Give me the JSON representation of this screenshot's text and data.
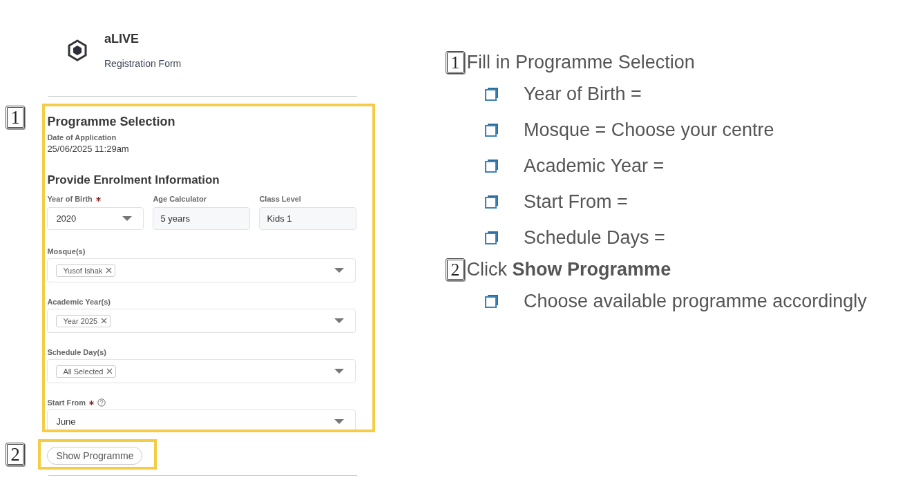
{
  "app": {
    "name": "aLIVE",
    "subtitle": "Registration Form"
  },
  "form": {
    "step": "1",
    "title": "Programme Selection",
    "date_label": "Date of Application",
    "date_value": "25/06/2025 11:29am",
    "section": "Provide Enrolment Information",
    "row_fields": [
      {
        "label": "Year of Birth",
        "required": true,
        "kind": "select",
        "value": "2020"
      },
      {
        "label": "Age Calculator",
        "required": false,
        "kind": "readonly",
        "value": "5 years"
      },
      {
        "label": "Class Level",
        "required": false,
        "kind": "readonly",
        "value": "Kids 1"
      }
    ],
    "fields": [
      {
        "label": "Mosque(s)",
        "required": false,
        "help": false,
        "kind": "tags",
        "tags": [
          "Yusof Ishak"
        ]
      },
      {
        "label": "Academic Year(s)",
        "required": false,
        "help": false,
        "kind": "tags",
        "tags": [
          "Year 2025"
        ]
      },
      {
        "label": "Schedule Day(s)",
        "required": false,
        "help": false,
        "kind": "tags",
        "tags": [
          "All Selected"
        ]
      },
      {
        "label": "Start From",
        "required": true,
        "help": true,
        "kind": "select",
        "value": "June"
      }
    ]
  },
  "action": {
    "step": "2",
    "button": "Show Programme"
  },
  "instructions": [
    {
      "step": "1",
      "text": "Fill in Programme Selection",
      "children": [
        {
          "text": "Year of Birth ="
        },
        {
          "text": "Mosque = Choose your centre"
        },
        {
          "text": "Academic Year ="
        },
        {
          "text": "Start From ="
        },
        {
          "text": "Schedule Days ="
        }
      ]
    },
    {
      "step": "2",
      "text": "Click **Show Programme**",
      "children": [
        {
          "text": "Choose available programme accordingly"
        }
      ]
    }
  ]
}
